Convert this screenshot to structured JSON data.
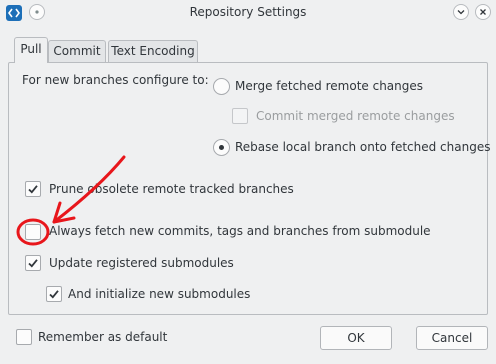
{
  "window": {
    "title": "Repository Settings"
  },
  "tabs": [
    {
      "label": "Pull",
      "active": true
    },
    {
      "label": "Commit",
      "active": false
    },
    {
      "label": "Text Encoding",
      "active": false
    }
  ],
  "pull": {
    "configure_label": "For new branches configure to:",
    "merge_option": {
      "label": "Merge fetched remote changes",
      "selected": false
    },
    "commit_merged": {
      "label": "Commit merged remote changes",
      "checked": false,
      "enabled": false
    },
    "rebase_option": {
      "label": "Rebase local branch onto fetched changes",
      "selected": true
    },
    "prune": {
      "label": "Prune obsolete remote tracked branches",
      "checked": true
    },
    "always_fetch": {
      "label": "Always fetch new commits, tags and branches from submodule",
      "checked": false
    },
    "update_submodules": {
      "label": "Update registered submodules",
      "checked": true
    },
    "init_submodules": {
      "label": "And initialize new submodules",
      "checked": true
    }
  },
  "footer": {
    "remember_default": {
      "label": "Remember as default",
      "checked": false
    },
    "ok_label": "OK",
    "cancel_label": "Cancel"
  },
  "colors": {
    "accent": "#3daee9",
    "annotation": "#e8161b",
    "app_icon": "#1d6fb8"
  },
  "icons": [
    "app-icon",
    "minimize-icon",
    "close-icon",
    "pin-icon",
    "checkmark-icon"
  ]
}
